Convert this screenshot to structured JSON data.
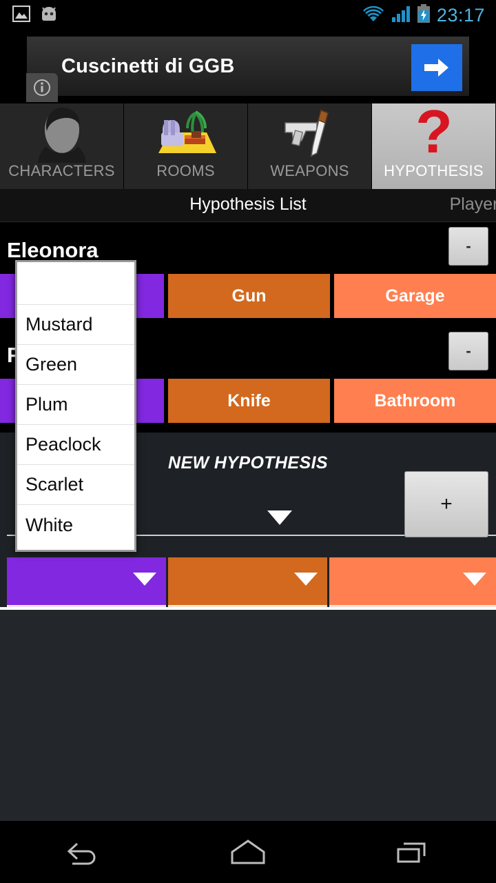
{
  "status_bar": {
    "clock": "23:17",
    "icons": [
      "image-icon",
      "android-head-icon",
      "wifi-icon",
      "signal-icon",
      "battery-charging-icon"
    ]
  },
  "ad": {
    "title": "Cuscinetti di GGB",
    "cta_icon": "arrow-right-icon",
    "info_icon": "info-icon"
  },
  "tabs": [
    {
      "label": "CHARACTERS",
      "icon": "person-silhouette-icon",
      "selected": false
    },
    {
      "label": "ROOMS",
      "icon": "armchair-plant-icon",
      "selected": false
    },
    {
      "label": "WEAPONS",
      "icon": "gun-knife-icon",
      "selected": false
    },
    {
      "label": "HYPOTHESIS",
      "icon": "question-mark-icon",
      "selected": true
    }
  ],
  "subheader": {
    "title": "Hypothesis List",
    "right_tab": "Players"
  },
  "hypotheses": [
    {
      "name": "Eleonora",
      "remove_label": "-",
      "character": "",
      "weapon": "Gun",
      "room": "Garage"
    },
    {
      "name": "F",
      "remove_label": "-",
      "character": "",
      "weapon": "Knife",
      "room": "Bathroom"
    }
  ],
  "new_hypothesis": {
    "title": "NEW HYPOTHESIS",
    "add_label": "+",
    "player_spinner_value": "",
    "character_spinner_value": "",
    "weapon_spinner_value": "",
    "room_spinner_value": "",
    "caret_icon": "dropdown-caret-icon"
  },
  "dropdown": {
    "items": [
      "",
      "Mustard",
      "Green",
      "Plum",
      "Peaclock",
      "Scarlet",
      "White"
    ]
  },
  "nav_bar": {
    "back": "back-icon",
    "home": "home-icon",
    "recents": "recents-icon"
  },
  "colors": {
    "character": "#8228e0",
    "weapon": "#d2691e",
    "room": "#ff7f50",
    "accent_blue": "#1e6fe8",
    "clock": "#4db6e2",
    "question": "#d81621"
  }
}
